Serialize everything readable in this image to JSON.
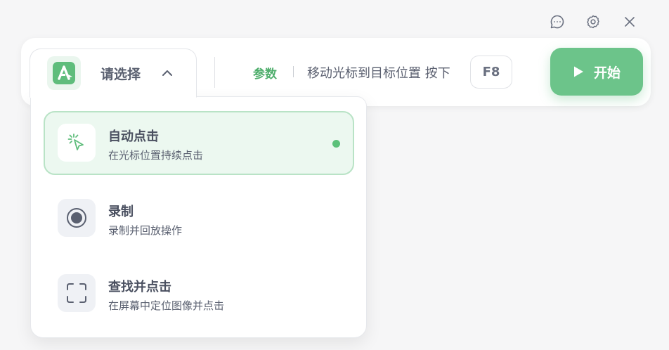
{
  "window": {
    "feedback_icon": "chat-bubble",
    "settings_icon": "gear",
    "close_icon": "close-x"
  },
  "toolbar": {
    "mode_selector": {
      "label": "请选择",
      "expanded": true,
      "logo_icon": "app-logo-A"
    },
    "param_label": "参数",
    "hint": "移动光标到目标位置 按下",
    "hotkey": "F8",
    "start_button": {
      "label": "开始",
      "icon": "play"
    }
  },
  "dropdown": {
    "options": [
      {
        "title": "自动点击",
        "description": "在光标位置持续点击",
        "icon": "cursor-click",
        "selected": true
      },
      {
        "title": "录制",
        "description": "录制并回放操作",
        "icon": "record",
        "selected": false
      },
      {
        "title": "查找并点击",
        "description": "在屏幕中定位图像并点击",
        "icon": "scan-frame",
        "selected": false
      }
    ]
  },
  "colors": {
    "accent": "#6cc48a",
    "accent_text": "#4fae6c",
    "selected_bg": "#ecf8f0",
    "selected_border": "#b9e3c6"
  }
}
